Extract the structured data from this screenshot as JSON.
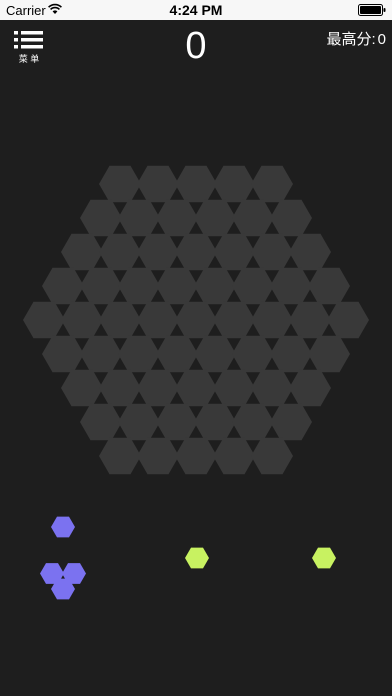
{
  "status_bar": {
    "carrier": "Carrier",
    "time": "4:24 PM"
  },
  "header": {
    "menu_label": "菜 单",
    "score": "0",
    "best_score_label": "最高分:",
    "best_score_value": "0"
  },
  "board": {
    "side_cells": 5,
    "cell_color": "#393939"
  },
  "pieces": [
    {
      "name": "flower-piece",
      "color": "#7b72f0",
      "cells": [
        [
          0,
          -1
        ],
        [
          -1,
          0.5
        ],
        [
          1,
          0.5
        ],
        [
          0,
          1
        ]
      ]
    },
    {
      "name": "single-piece-1",
      "color": "#c8f261",
      "cells": [
        [
          0,
          0
        ]
      ]
    },
    {
      "name": "single-piece-2",
      "color": "#c8f261",
      "cells": [
        [
          0,
          0
        ]
      ]
    }
  ]
}
